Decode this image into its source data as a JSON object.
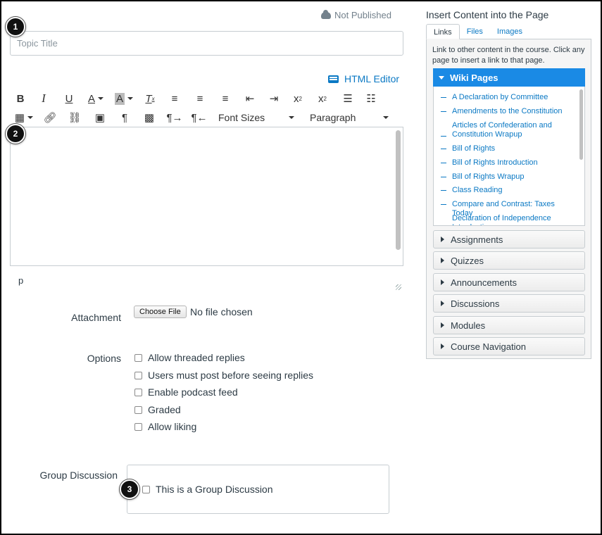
{
  "status": {
    "publish_label": "Not Published",
    "icon": "cloud-icon"
  },
  "title_input": {
    "placeholder": "Topic Title"
  },
  "badges": {
    "one": "1",
    "two": "2",
    "three": "3"
  },
  "editor": {
    "html_editor_label": "HTML Editor",
    "font_sizes_label": "Font Sizes",
    "paragraph_label": "Paragraph",
    "path": "p",
    "toolbar1": [
      "bold-icon",
      "italic-icon",
      "underline-icon",
      "text-color-icon",
      "background-color-icon",
      "clear-formatting-icon",
      "align-left-icon",
      "align-center-icon",
      "align-right-icon",
      "outdent-icon",
      "indent-icon",
      "superscript-icon",
      "subscript-icon",
      "bullet-list-icon",
      "numbered-list-icon"
    ],
    "toolbar2": [
      "table-icon",
      "link-icon",
      "unlink-icon",
      "image-icon",
      "paragraph-mark-icon",
      "media-icon",
      "ltr-icon",
      "rtl-icon"
    ]
  },
  "attachment": {
    "label": "Attachment",
    "button": "Choose File",
    "status": "No file chosen"
  },
  "options": {
    "label": "Options",
    "items": [
      "Allow threaded replies",
      "Users must post before seeing replies",
      "Enable podcast feed",
      "Graded",
      "Allow liking"
    ]
  },
  "group": {
    "label": "Group Discussion",
    "checkbox": "This is a Group Discussion"
  },
  "panel": {
    "title": "Insert Content into the Page",
    "tabs": [
      "Links",
      "Files",
      "Images"
    ],
    "description": "Link to other content in the course. Click any page to insert a link to that page.",
    "wiki_header": "Wiki Pages",
    "wiki_items": [
      "A Declaration by Committee",
      "Amendments to the Constitution",
      "Articles of Confederation and Constitution Wrapup",
      "Bill of Rights",
      "Bill of Rights Introduction",
      "Bill of Rights Wrapup",
      "Class Reading",
      "Compare and Contrast: Taxes Today",
      "Declaration of Independence Introduction"
    ],
    "sections": [
      "Assignments",
      "Quizzes",
      "Announcements",
      "Discussions",
      "Modules",
      "Course Navigation"
    ]
  },
  "colors": {
    "link": "#0b79c4",
    "accent": "#1a8ae5",
    "text": "#2d3b45"
  }
}
